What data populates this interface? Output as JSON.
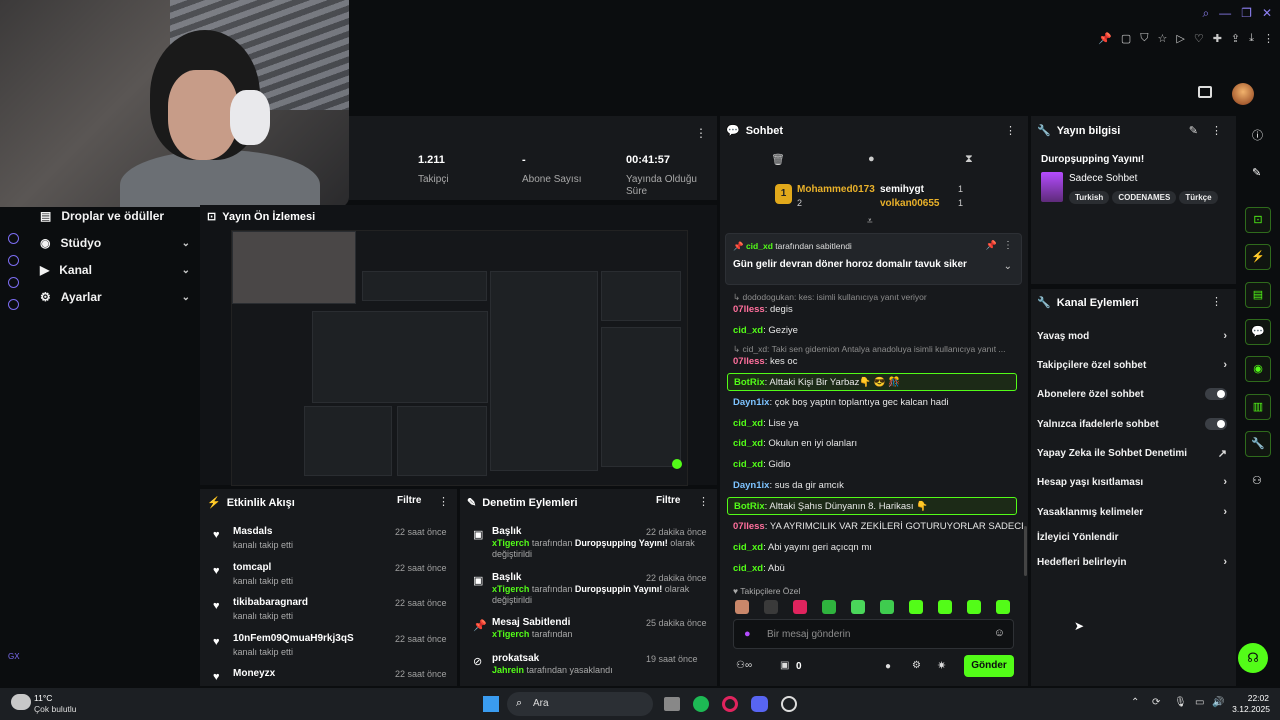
{
  "stats": [
    {
      "value": "1.211",
      "label": "Takipçi"
    },
    {
      "value": "-",
      "label": "Abone Sayısı"
    },
    {
      "value": "00:41:57",
      "label": "Yayında Olduğu Süre"
    }
  ],
  "sidebar": {
    "items": [
      {
        "label": "Droplar ve ödüller"
      },
      {
        "label": "Stüdyo"
      },
      {
        "label": "Kanal"
      },
      {
        "label": "Ayarlar"
      }
    ]
  },
  "preview": {
    "title": "Yayın Ön İzlemesi"
  },
  "activity": {
    "title": "Etkinlik Akışı",
    "filter": "Filtre",
    "items": [
      {
        "name": "Masdals",
        "sub": "kanalı takip etti",
        "time": "22 saat önce"
      },
      {
        "name": "tomcapl",
        "sub": "kanalı takip etti",
        "time": "22 saat önce"
      },
      {
        "name": "tikibabaragnard",
        "sub": "kanalı takip etti",
        "time": "22 saat önce"
      },
      {
        "name": "10nFem09QmuaH9rkj3qS",
        "sub": "kanalı takip etti",
        "time": "22 saat önce"
      },
      {
        "name": "Moneyzx",
        "sub": "",
        "time": "22 saat önce"
      }
    ]
  },
  "moderation": {
    "title": "Denetim Eylemleri",
    "filter": "Filtre",
    "items": [
      {
        "name": "Başlık",
        "user": "xTigerch",
        "mid": " tarafından ",
        "bold": "Duropşupping Yayını!",
        "end": " olarak değiştirildi",
        "time": "22 dakika önce"
      },
      {
        "name": "Başlık",
        "user": "xTigerch",
        "mid": " tarafından ",
        "bold": "Duropşuppin Yayını!",
        "end": " olarak değiştirildi",
        "time": "22 dakika önce"
      },
      {
        "name": "Mesaj Sabitlendi",
        "user": "xTigerch",
        "mid": " tarafından",
        "bold": "",
        "end": "",
        "time": "25 dakika önce"
      },
      {
        "name": "prokatsak",
        "user": "Jahrein",
        "mid": " tarafından yasaklandı",
        "bold": "",
        "end": "",
        "time": "19 saat önce"
      }
    ]
  },
  "chat": {
    "title": "Sohbet",
    "top_gifters": [
      {
        "rank": "1",
        "name": "Mohammed0173",
        "count": "2"
      },
      {
        "rank": "",
        "name": "semihygt",
        "count": "1"
      },
      {
        "rank": "",
        "name": "volkan00655",
        "count": "1"
      }
    ],
    "pinned": {
      "by": "cid_xd",
      "by_suffix": " tarafından sabitlendi",
      "text": "Gün gelir devran döner horoz domalır tavuk siker"
    },
    "messages": [
      {
        "type": "reply",
        "text": "↳ dododogukan: kes: isimli kullanıcıya yanıt veriyor"
      },
      {
        "type": "msg",
        "user": "07lless",
        "color": "pink",
        "text": "degis"
      },
      {
        "type": "msg",
        "user": "cid_xd",
        "color": "green",
        "text": "Geziye"
      },
      {
        "type": "reply",
        "text": "↳ cid_xd: Taki sen gidemion Antalya anadoluya isimli kullanıcıya yanıt ..."
      },
      {
        "type": "msg",
        "user": "07lless",
        "color": "pink",
        "text": "kes oc"
      },
      {
        "type": "bot",
        "user": "BotRix",
        "text": "Alttaki Kişi Bir Yarbaz👇 😎 🎊"
      },
      {
        "type": "msg",
        "user": "Dayn1ix",
        "color": "blue",
        "text": "çok boş yaptın toplantıya gec kalcan hadi"
      },
      {
        "type": "msg",
        "user": "cid_xd",
        "color": "green",
        "text": "Lise ya"
      },
      {
        "type": "msg",
        "user": "cid_xd",
        "color": "green",
        "text": "Okulun en iyi olanları"
      },
      {
        "type": "msg",
        "user": "cid_xd",
        "color": "green",
        "text": "Gidio"
      },
      {
        "type": "msg",
        "user": "Dayn1ix",
        "color": "blue",
        "text": "sus da gir amcık"
      },
      {
        "type": "bot",
        "user": "BotRix",
        "text": "Alttaki Şahıs Dünyanın 8. Harikası 👇"
      },
      {
        "type": "msg",
        "user": "07lless",
        "color": "pink",
        "text": "YA AYRIMCILIK VAR ZEKİLERİ GOTURUYORLAR SADECE"
      },
      {
        "type": "msg",
        "user": "cid_xd",
        "color": "green",
        "text": "Abi yayını geri açıcqn mı"
      },
      {
        "type": "msg",
        "user": "cid_xd",
        "color": "green",
        "text": "Abü"
      }
    ],
    "followers_only": "Takipçilere Özel",
    "input_placeholder": "Bir mesaj gönderin",
    "points": "0",
    "send": "Gönder"
  },
  "stream_info": {
    "title": "Yayın bilgisi",
    "stream_title": "Duropşupping Yayını!",
    "category": "Sadece Sohbet",
    "tags": [
      "Turkish",
      "CODENAMES",
      "Türkçe"
    ]
  },
  "channel_actions": {
    "title": "Kanal Eylemleri",
    "items": [
      {
        "label": "Yavaş mod",
        "kind": "chev"
      },
      {
        "label": "Takipçilere özel sohbet",
        "kind": "chev"
      },
      {
        "label": "Abonelere özel sohbet",
        "kind": "toggle"
      },
      {
        "label": "Yalnızca ifadelerle sohbet",
        "kind": "toggle"
      },
      {
        "label": "Yapay Zeka ile Sohbet Denetimi",
        "kind": "ext"
      },
      {
        "label": "Hesap yaşı kısıtlaması",
        "kind": "chev"
      },
      {
        "label": "Yasaklanmış kelimeler",
        "kind": "chev"
      },
      {
        "label": "İzleyici Yönlendir",
        "kind": "none"
      },
      {
        "label": "Hedefleri belirleyin",
        "kind": "chev"
      }
    ]
  },
  "taskbar": {
    "weather_temp": "11°C",
    "weather_desc": "Çok bulutlu",
    "search": "Ara",
    "time": "22:02",
    "date": "3.12.2025"
  },
  "colors": {
    "accent": "#53fc18",
    "panel": "#17191c",
    "bg": "#0b0d0f"
  }
}
